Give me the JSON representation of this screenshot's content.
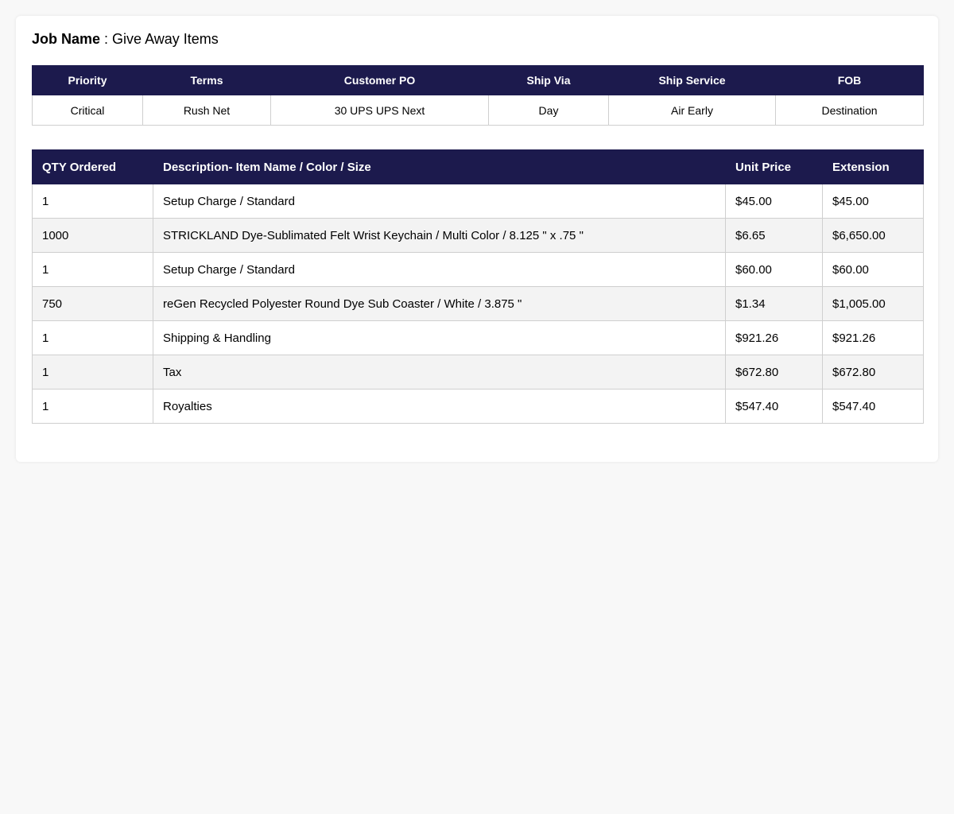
{
  "job": {
    "label": "Job Name",
    "separator": " : ",
    "value": "Give Away Items"
  },
  "info": {
    "headers": [
      "Priority",
      "Terms",
      "Customer PO",
      "Ship Via",
      "Ship Service",
      "FOB"
    ],
    "values": [
      "Critical",
      "Rush Net",
      "30 UPS UPS Next",
      "Day",
      "Air Early",
      "Destination"
    ]
  },
  "items": {
    "headers": [
      "QTY Ordered",
      "Description- Item Name / Color / Size",
      "Unit Price",
      "Extension"
    ],
    "rows": [
      {
        "qty": "1",
        "description": "Setup Charge / Standard",
        "unit_price": "$45.00",
        "extension": "$45.00"
      },
      {
        "qty": "1000",
        "description": "STRICKLAND Dye-Sublimated Felt Wrist Keychain / Multi Color / 8.125 \" x .75 \"",
        "unit_price": "$6.65",
        "extension": "$6,650.00"
      },
      {
        "qty": "1",
        "description": "Setup Charge / Standard",
        "unit_price": "$60.00",
        "extension": "$60.00"
      },
      {
        "qty": "750",
        "description": "reGen Recycled Polyester Round Dye Sub Coaster / White / 3.875 \"",
        "unit_price": "$1.34",
        "extension": "$1,005.00"
      },
      {
        "qty": "1",
        "description": "Shipping & Handling",
        "unit_price": "$921.26",
        "extension": "$921.26"
      },
      {
        "qty": "1",
        "description": "Tax",
        "unit_price": "$672.80",
        "extension": "$672.80"
      },
      {
        "qty": "1",
        "description": "Royalties",
        "unit_price": "$547.40",
        "extension": "$547.40"
      }
    ]
  },
  "colors": {
    "header_bg": "#1c1a4d",
    "header_text": "#ffffff",
    "row_alt": "#f3f3f3",
    "border": "#cfcfcf"
  }
}
